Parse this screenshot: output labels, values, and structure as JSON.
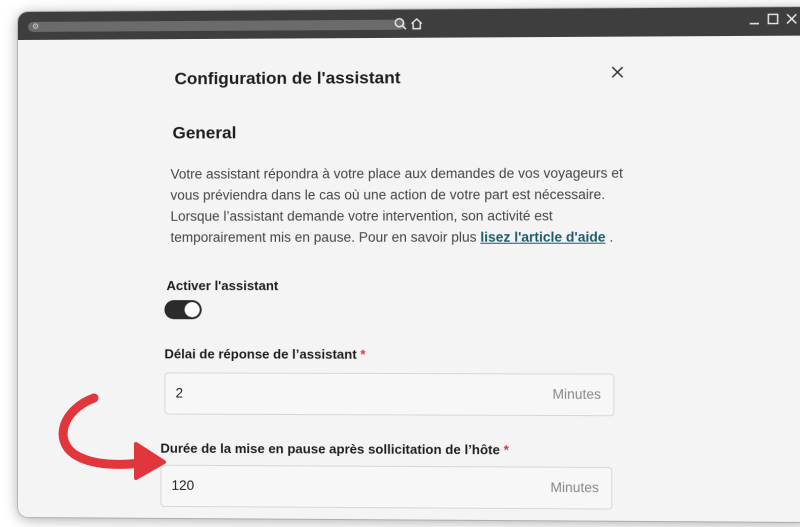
{
  "dialog": {
    "title": "Configuration de l'assistant",
    "section_title": "General",
    "description": "Votre assistant répondra à votre place aux demandes de vos voyageurs et vous préviendra dans le cas où une action de votre part est nécessaire. Lorsque l’assistant demande votre intervention, son activité est temporairement mis en pause. Pour en savoir plus",
    "help_link": "lisez l'article d'aide",
    "description_end": ".",
    "activate_label": "Activer l'assistant",
    "activate_on": true,
    "response_delay": {
      "label": "Délai de réponse de l’assistant",
      "required_mark": "*",
      "value": "2",
      "unit": "Minutes"
    },
    "pause_duration": {
      "label": "Durée de la mise en pause après sollicitation de l’hôte",
      "required_mark": "*",
      "value": "120",
      "unit": "Minutes"
    }
  },
  "colors": {
    "annotation_arrow": "#e0363c",
    "link": "#1b5a6b",
    "required": "#d9363e",
    "toggle_on": "#2b2b2b"
  },
  "icons": {
    "search": "search-icon",
    "home": "home-icon",
    "close": "close-icon",
    "minimize": "minimize-icon",
    "maximize": "maximize-icon",
    "window_close": "window-close-icon"
  }
}
